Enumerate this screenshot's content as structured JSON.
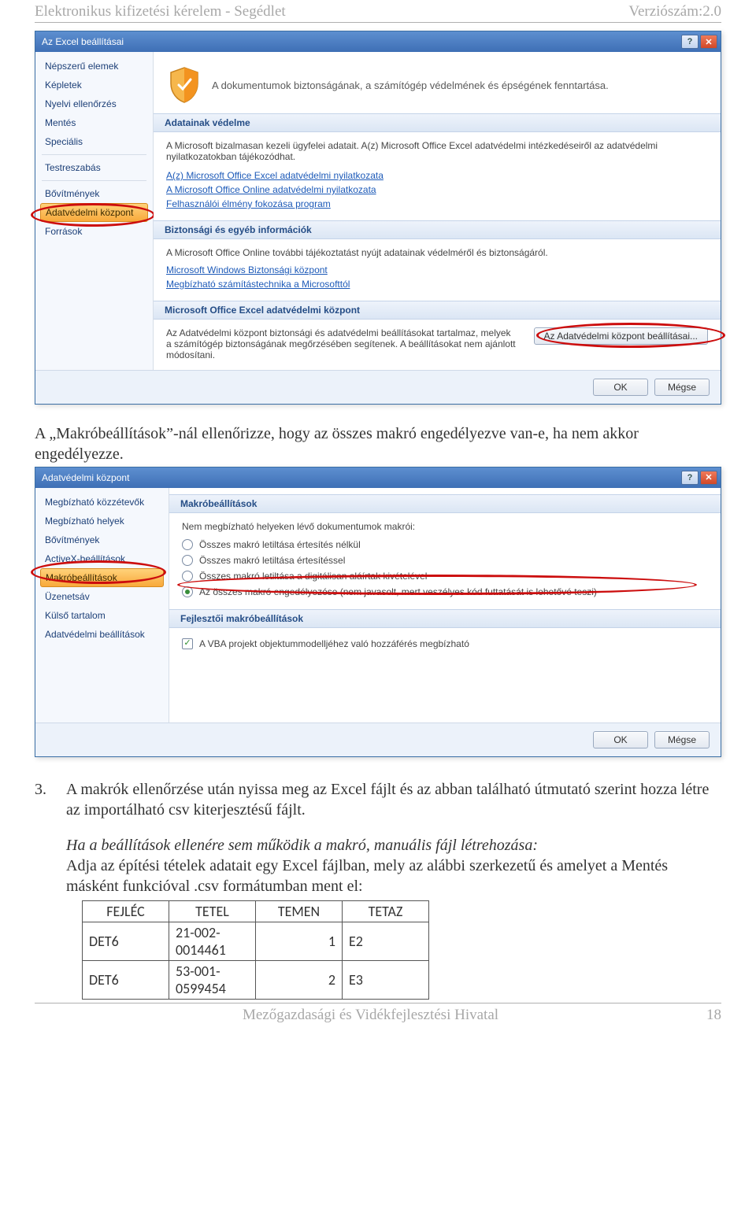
{
  "header": {
    "left": "Elektronikus kifizetési kérelem - Segédlet",
    "right": "Verziószám:2.0"
  },
  "footer": {
    "center": "Mezőgazdasági és Vidékfejlesztési Hivatal",
    "page": "18"
  },
  "fig1": {
    "title": "Az Excel beállításai",
    "sidebar": {
      "items": [
        "Népszerű elemek",
        "Képletek",
        "Nyelvi ellenőrzés",
        "Mentés",
        "Speciális",
        "Testreszabás",
        "Bővítmények",
        "Adatvédelmi központ",
        "Források"
      ],
      "active_index": 7
    },
    "banner": "A dokumentumok biztonságának, a számítógép védelmének és épségének fenntartása.",
    "sections": {
      "s1": {
        "head": "Adatainak védelme",
        "body": "A Microsoft bizalmasan kezeli ügyfelei adatait. A(z) Microsoft Office Excel adatvédelmi intézkedéseiről az adatvédelmi nyilatkozatokban tájékozódhat.",
        "links": [
          "A(z) Microsoft Office Excel adatvédelmi nyilatkozata",
          "A Microsoft Office Online adatvédelmi nyilatkozata",
          "Felhasználói élmény fokozása program"
        ]
      },
      "s2": {
        "head": "Biztonsági és egyéb információk",
        "body": "A Microsoft Office Online további tájékoztatást nyújt adatainak védelméről és biztonságáról.",
        "links": [
          "Microsoft Windows Biztonsági központ",
          "Megbízható számítástechnika a Microsofttól"
        ]
      },
      "s3": {
        "head": "Microsoft Office Excel adatvédelmi központ",
        "body": "Az Adatvédelmi központ biztonsági és adatvédelmi beállításokat tartalmaz, melyek a számítógép biztonságának megőrzésében segítenek. A beállításokat nem ajánlott módosítani.",
        "button": "Az Adatvédelmi központ beállításai..."
      }
    },
    "footer": {
      "ok": "OK",
      "cancel": "Mégse"
    }
  },
  "para1": "A „Makróbeállítások”-nál ellenőrizze, hogy az összes makró engedélyezve van-e, ha nem akkor engedélyezze.",
  "fig2": {
    "title": "Adatvédelmi központ",
    "sidebar": {
      "items": [
        "Megbízható közzétevők",
        "Megbízható helyek",
        "Bővítmények",
        "ActiveX-beállítások",
        "Makróbeállítások",
        "Üzenetsáv",
        "Külső tartalom",
        "Adatvédelmi beállítások"
      ],
      "active_index": 4
    },
    "s1": {
      "head": "Makróbeállítások",
      "intro": "Nem megbízható helyeken lévő dokumentumok makrói:",
      "opts": [
        "Összes makró letiltása értesítés nélkül",
        "Összes makró letiltása értesítéssel",
        "Összes makró letiltása a digitálisan aláírtak kivételével",
        "Az összes makró engedélyezése (nem javasolt, mert veszélyes kód futtatását is lehetővé teszi)"
      ],
      "selected": 3
    },
    "s2": {
      "head": "Fejlesztői makróbeállítások",
      "check": "A VBA projekt objektummodelljéhez való hozzáférés megbízható"
    },
    "footer": {
      "ok": "OK",
      "cancel": "Mégse"
    }
  },
  "para2_num": "3.",
  "para2": "A makrók ellenőrzése után nyissa meg az Excel fájlt és az abban található útmutató szerint hozza létre az importálható csv kiterjesztésű fájlt.",
  "para3a": "Ha a beállítások ellenére sem működik a makró, manuális fájl létrehozása:",
  "para3b": "Adja az építési tételek adatait egy Excel fájlban, mely az alábbi szerkezetű és amelyet a Mentés másként funkcióval .csv formátumban ment el:",
  "csv": {
    "headers": [
      "FEJLÉC",
      "TETEL",
      "TEMEN",
      "TETAZ"
    ],
    "rows": [
      {
        "c1": "DET6",
        "c2a": "21-002-",
        "c2b": "0014461",
        "c3": "1",
        "c4": "E2"
      },
      {
        "c1": "DET6",
        "c2a": "53-001-",
        "c2b": "0599454",
        "c3": "2",
        "c4": "E3"
      }
    ]
  }
}
